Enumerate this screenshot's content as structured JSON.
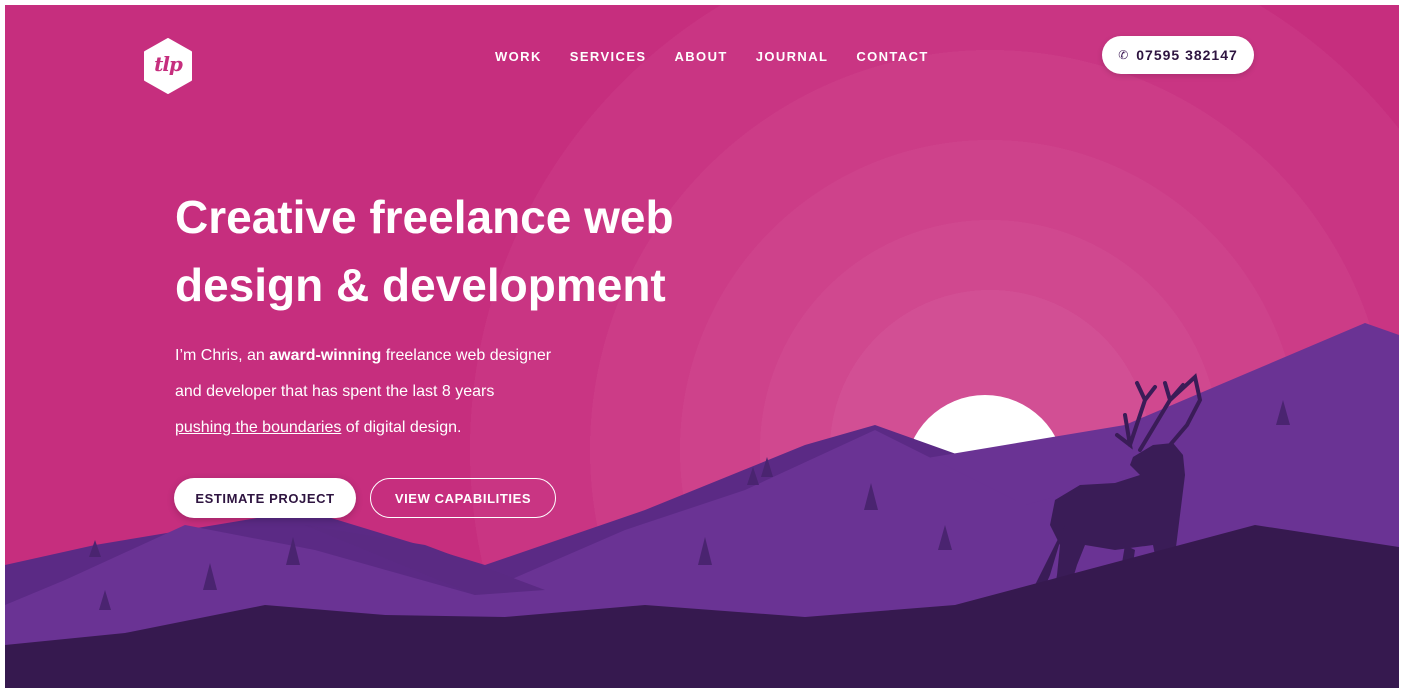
{
  "brand": {
    "logo_text": "tlp"
  },
  "nav": {
    "items": [
      "WORK",
      "SERVICES",
      "ABOUT",
      "JOURNAL",
      "CONTACT"
    ]
  },
  "contact": {
    "phone": "07595 382147",
    "phone_icon": "phone-icon"
  },
  "hero": {
    "headline_line1": "Creative freelance web",
    "headline_line2": "design & development",
    "intro_part1": "I’m Chris, an ",
    "intro_bold": "award-winning",
    "intro_part2": " freelance web designer",
    "intro_line2": "and developer that has spent the last 8 years",
    "intro_link": "pushing the boundaries",
    "intro_part3": " of digital design."
  },
  "actions": {
    "estimate_label": "ESTIMATE PROJECT",
    "capabilities_label": "VIEW CAPABILITIES"
  },
  "colors": {
    "background_pink": "#c62e7e",
    "mountain_purple": "#6a3394",
    "deep_purple": "#36194f",
    "text_dark": "#2e1440"
  }
}
